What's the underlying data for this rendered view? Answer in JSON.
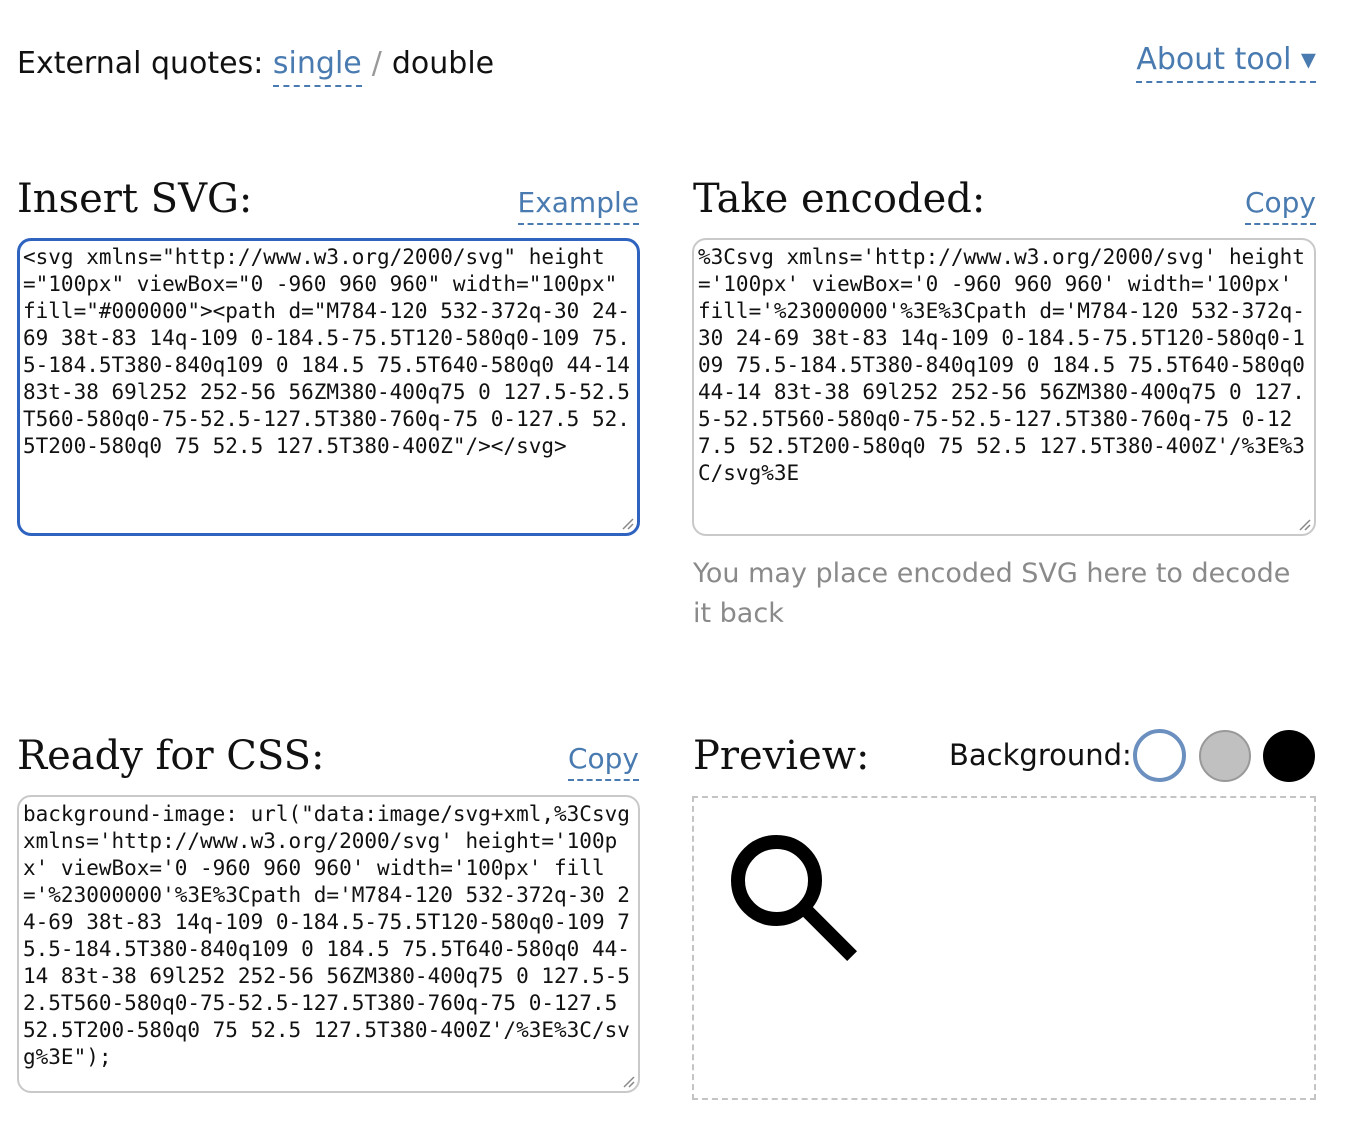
{
  "quotes": {
    "label": "External quotes:",
    "single": "single",
    "divider": "/",
    "double": "double"
  },
  "about": {
    "label": "About tool ▾"
  },
  "insert": {
    "title": "Insert SVG:",
    "example": "Example",
    "value": "<svg xmlns=\"http://www.w3.org/2000/svg\" height=\"100px\" viewBox=\"0 -960 960 960\" width=\"100px\" fill=\"#000000\"><path d=\"M784-120 532-372q-30 24-69 38t-83 14q-109 0-184.5-75.5T120-580q0-109 75.5-184.5T380-840q109 0 184.5 75.5T640-580q0 44-14 83t-38 69l252 252-56 56ZM380-400q75 0 127.5-52.5T560-580q0-75-52.5-127.5T380-760q-75 0-127.5 52.5T200-580q0 75 52.5 127.5T380-400Z\"/></svg>"
  },
  "encoded": {
    "title": "Take encoded:",
    "copy": "Copy",
    "value": "%3Csvg xmlns='http://www.w3.org/2000/svg' height='100px' viewBox='0 -960 960 960' width='100px' fill='%23000000'%3E%3Cpath d='M784-120 532-372q-30 24-69 38t-83 14q-109 0-184.5-75.5T120-580q0-109 75.5-184.5T380-840q109 0 184.5 75.5T640-580q0 44-14 83t-38 69l252 252-56 56ZM380-400q75 0 127.5-52.5T560-580q0-75-52.5-127.5T380-760q-75 0-127.5 52.5T200-580q0 75 52.5 127.5T380-400Z'/%3E%3C/svg%3E",
    "hint": "You may place encoded SVG here to decode it back"
  },
  "css": {
    "title": "Ready for CSS:",
    "copy": "Copy",
    "value": "background-image: url(\"data:image/svg+xml,%3Csvg xmlns='http://www.w3.org/2000/svg' height='100px' viewBox='0 -960 960 960' width='100px' fill='%23000000'%3E%3Cpath d='M784-120 532-372q-30 24-69 38t-83 14q-109 0-184.5-75.5T120-580q0-109 75.5-184.5T380-840q109 0 184.5 75.5T640-580q0 44-14 83t-38 69l252 252-56 56ZM380-400q75 0 127.5-52.5T560-580q0-75-52.5-127.5T380-760q-75 0-127.5 52.5T200-580q0 75 52.5 127.5T380-400Z'/%3E%3C/svg%3E\");"
  },
  "preview": {
    "title": "Preview:",
    "background_label": "Background:",
    "swatches": [
      {
        "name": "white",
        "color": "#ffffff",
        "selected": true
      },
      {
        "name": "silver",
        "color": "#c0c0c0",
        "selected": false
      },
      {
        "name": "black",
        "color": "#000000",
        "selected": false
      }
    ],
    "icon": "search-icon"
  },
  "colors": {
    "link": "#4a7bb0",
    "active_border": "#2f63c0",
    "hint": "#8a8a8a"
  }
}
